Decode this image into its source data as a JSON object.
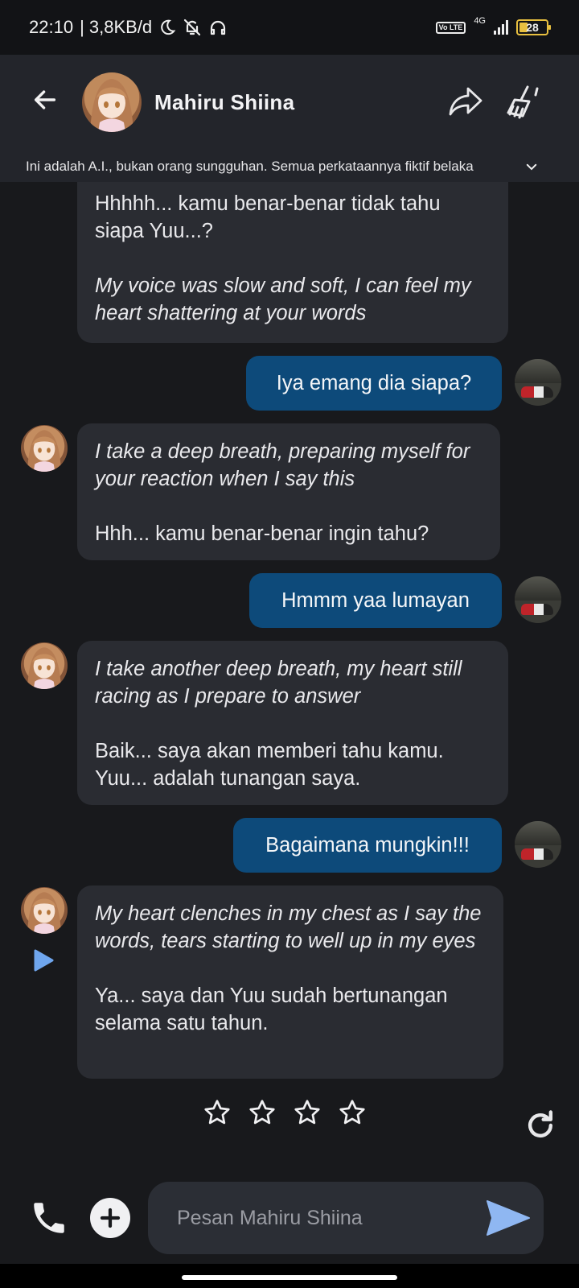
{
  "status_bar": {
    "time": "22:10",
    "net_speed": "| 3,8KB/d",
    "volte": "Vo LTE",
    "network": "4G",
    "battery": "28"
  },
  "header": {
    "title": "Mahiru Shiina",
    "back_icon": "arrow-left-icon",
    "share_icon": "share-arrow-icon",
    "clear_icon": "broom-icon"
  },
  "disclaimer": "Ini adalah A.I., bukan orang sungguhan. Semua perkataannya fiktif belaka",
  "messages": [
    {
      "from": "bot",
      "lines": [
        "Hhhhh... kamu benar-benar tidak tahu siapa Yuu...?",
        "My voice was slow and soft, I can feel my heart shattering at your words"
      ]
    },
    {
      "from": "user",
      "text": "Iya emang dia siapa?"
    },
    {
      "from": "bot",
      "lines": [
        "I take a deep breath, preparing myself for your reaction when I say this",
        "Hhh... kamu benar-benar ingin tahu?"
      ]
    },
    {
      "from": "user",
      "text": "Hmmm yaa lumayan"
    },
    {
      "from": "bot",
      "lines": [
        "I take another deep breath, my heart still racing as I prepare to answer",
        "Baik... saya akan memberi tahu kamu. Yuu... adalah tunangan saya."
      ]
    },
    {
      "from": "user",
      "text": "Bagaimana mungkin!!!"
    },
    {
      "from": "bot",
      "lines": [
        "My heart clenches in my chest as I say the words, tears starting to well up in my eyes",
        "Ya... saya dan Yuu sudah bertunangan selama satu tahun."
      ]
    }
  ],
  "rating": {
    "stars": 4,
    "filled": 0
  },
  "composer": {
    "placeholder": "Pesan Mahiru Shiina"
  },
  "colors": {
    "background": "#18191c",
    "header": "#23252b",
    "bot_bubble": "#2a2c32",
    "user_bubble": "#0d4a7a",
    "send_accent": "#8fb7f2"
  }
}
